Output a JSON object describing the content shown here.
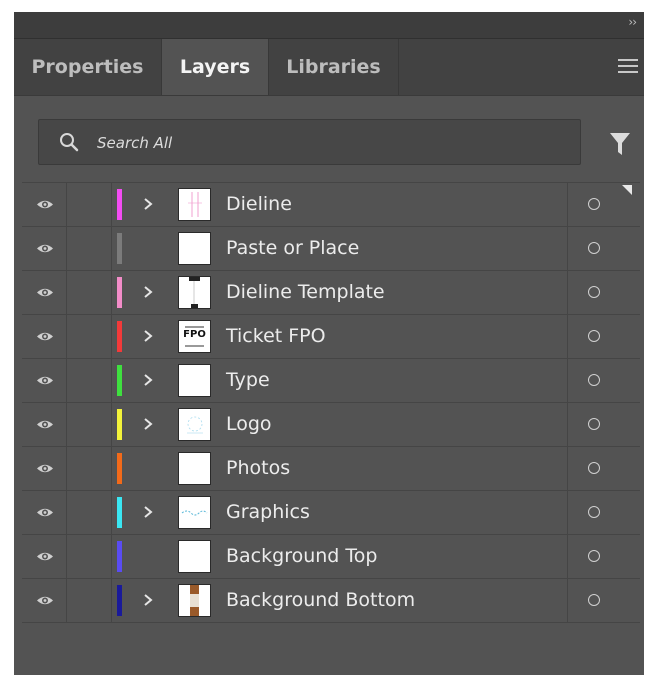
{
  "tabs": [
    {
      "label": "Properties",
      "active": false
    },
    {
      "label": "Layers",
      "active": true
    },
    {
      "label": "Libraries",
      "active": false
    }
  ],
  "search": {
    "placeholder": "Search All"
  },
  "layers": [
    {
      "name": "Dieline",
      "color": "#f24cf2",
      "expandable": true,
      "thumb": "dieline"
    },
    {
      "name": "Paste or Place",
      "color": "#7b7b7b",
      "expandable": false,
      "thumb": "blank"
    },
    {
      "name": "Dieline Template",
      "color": "#f28cc8",
      "expandable": true,
      "thumb": "template"
    },
    {
      "name": "Ticket FPO",
      "color": "#f23a3a",
      "expandable": true,
      "thumb": "fpo",
      "thumb_text": "FPO"
    },
    {
      "name": "Type",
      "color": "#3fe03f",
      "expandable": true,
      "thumb": "blank"
    },
    {
      "name": "Logo",
      "color": "#f2f23a",
      "expandable": true,
      "thumb": "logo"
    },
    {
      "name": "Photos",
      "color": "#f26a1a",
      "expandable": false,
      "thumb": "blank"
    },
    {
      "name": "Graphics",
      "color": "#3ae6f2",
      "expandable": true,
      "thumb": "graphics"
    },
    {
      "name": "Background Top",
      "color": "#5a4cf2",
      "expandable": false,
      "thumb": "blank"
    },
    {
      "name": "Background Bottom",
      "color": "#1a1a9a",
      "expandable": true,
      "thumb": "bgbottom"
    }
  ]
}
